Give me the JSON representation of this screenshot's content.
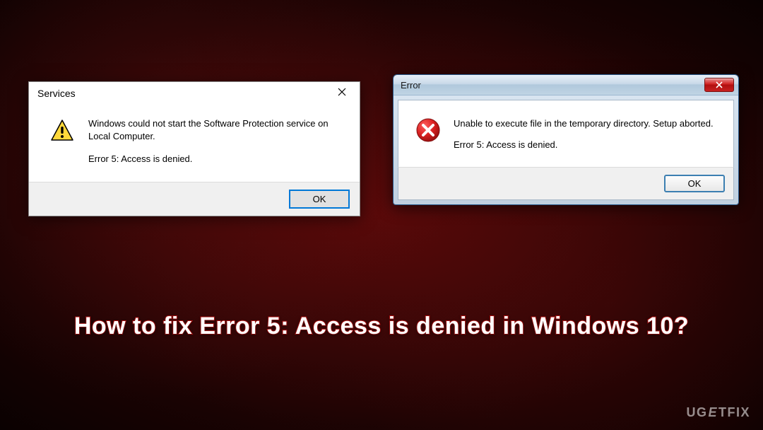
{
  "dialog1": {
    "title": "Services",
    "message1": "Windows could not start the Software Protection service on Local Computer.",
    "message2": "Error 5: Access is denied.",
    "ok": "OK"
  },
  "dialog2": {
    "title": "Error",
    "message1": "Unable to execute file in the temporary directory. Setup aborted.",
    "message2": "Error 5: Access is denied.",
    "ok": "OK"
  },
  "headline": "How to fix Error 5: Access is denied in Windows 10?",
  "watermark": {
    "pre": "UG",
    "mid": "E",
    "post": "TFIX"
  }
}
